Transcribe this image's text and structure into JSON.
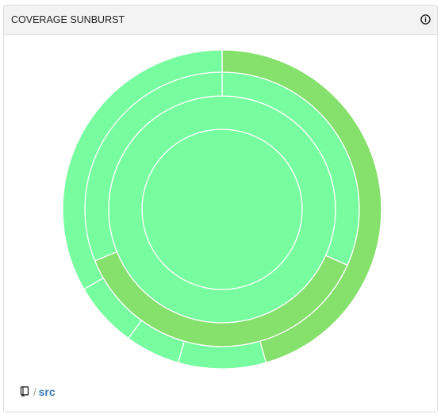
{
  "panel": {
    "title": "COVERAGE SUNBURST",
    "info_icon": "info-circle-icon"
  },
  "breadcrumb": {
    "root_icon": "repository-icon",
    "separator": "/",
    "current": "src"
  },
  "colors": {
    "light_green": "#78fca0",
    "medium_green": "#86e06c",
    "segment_border": "#ffffff"
  },
  "sunburst": {
    "rings": [
      {
        "segments": [
          {
            "start": 0,
            "end": 360,
            "color": "light_green"
          }
        ]
      },
      {
        "segments": [
          {
            "start": 0,
            "end": 360,
            "color": "light_green"
          }
        ]
      },
      {
        "segments": [
          {
            "start": 0,
            "end": 114,
            "color": "light_green"
          },
          {
            "start": 114,
            "end": 248,
            "color": "medium_green"
          },
          {
            "start": 248,
            "end": 360,
            "color": "light_green"
          }
        ]
      },
      {
        "segments": [
          {
            "start": 0,
            "end": 164,
            "color": "medium_green"
          },
          {
            "start": 164,
            "end": 196,
            "color": "light_green"
          },
          {
            "start": 196,
            "end": 216,
            "color": "light_green"
          },
          {
            "start": 216,
            "end": 240,
            "color": "light_green"
          },
          {
            "start": 240,
            "end": 360,
            "color": "light_green"
          }
        ]
      }
    ]
  }
}
